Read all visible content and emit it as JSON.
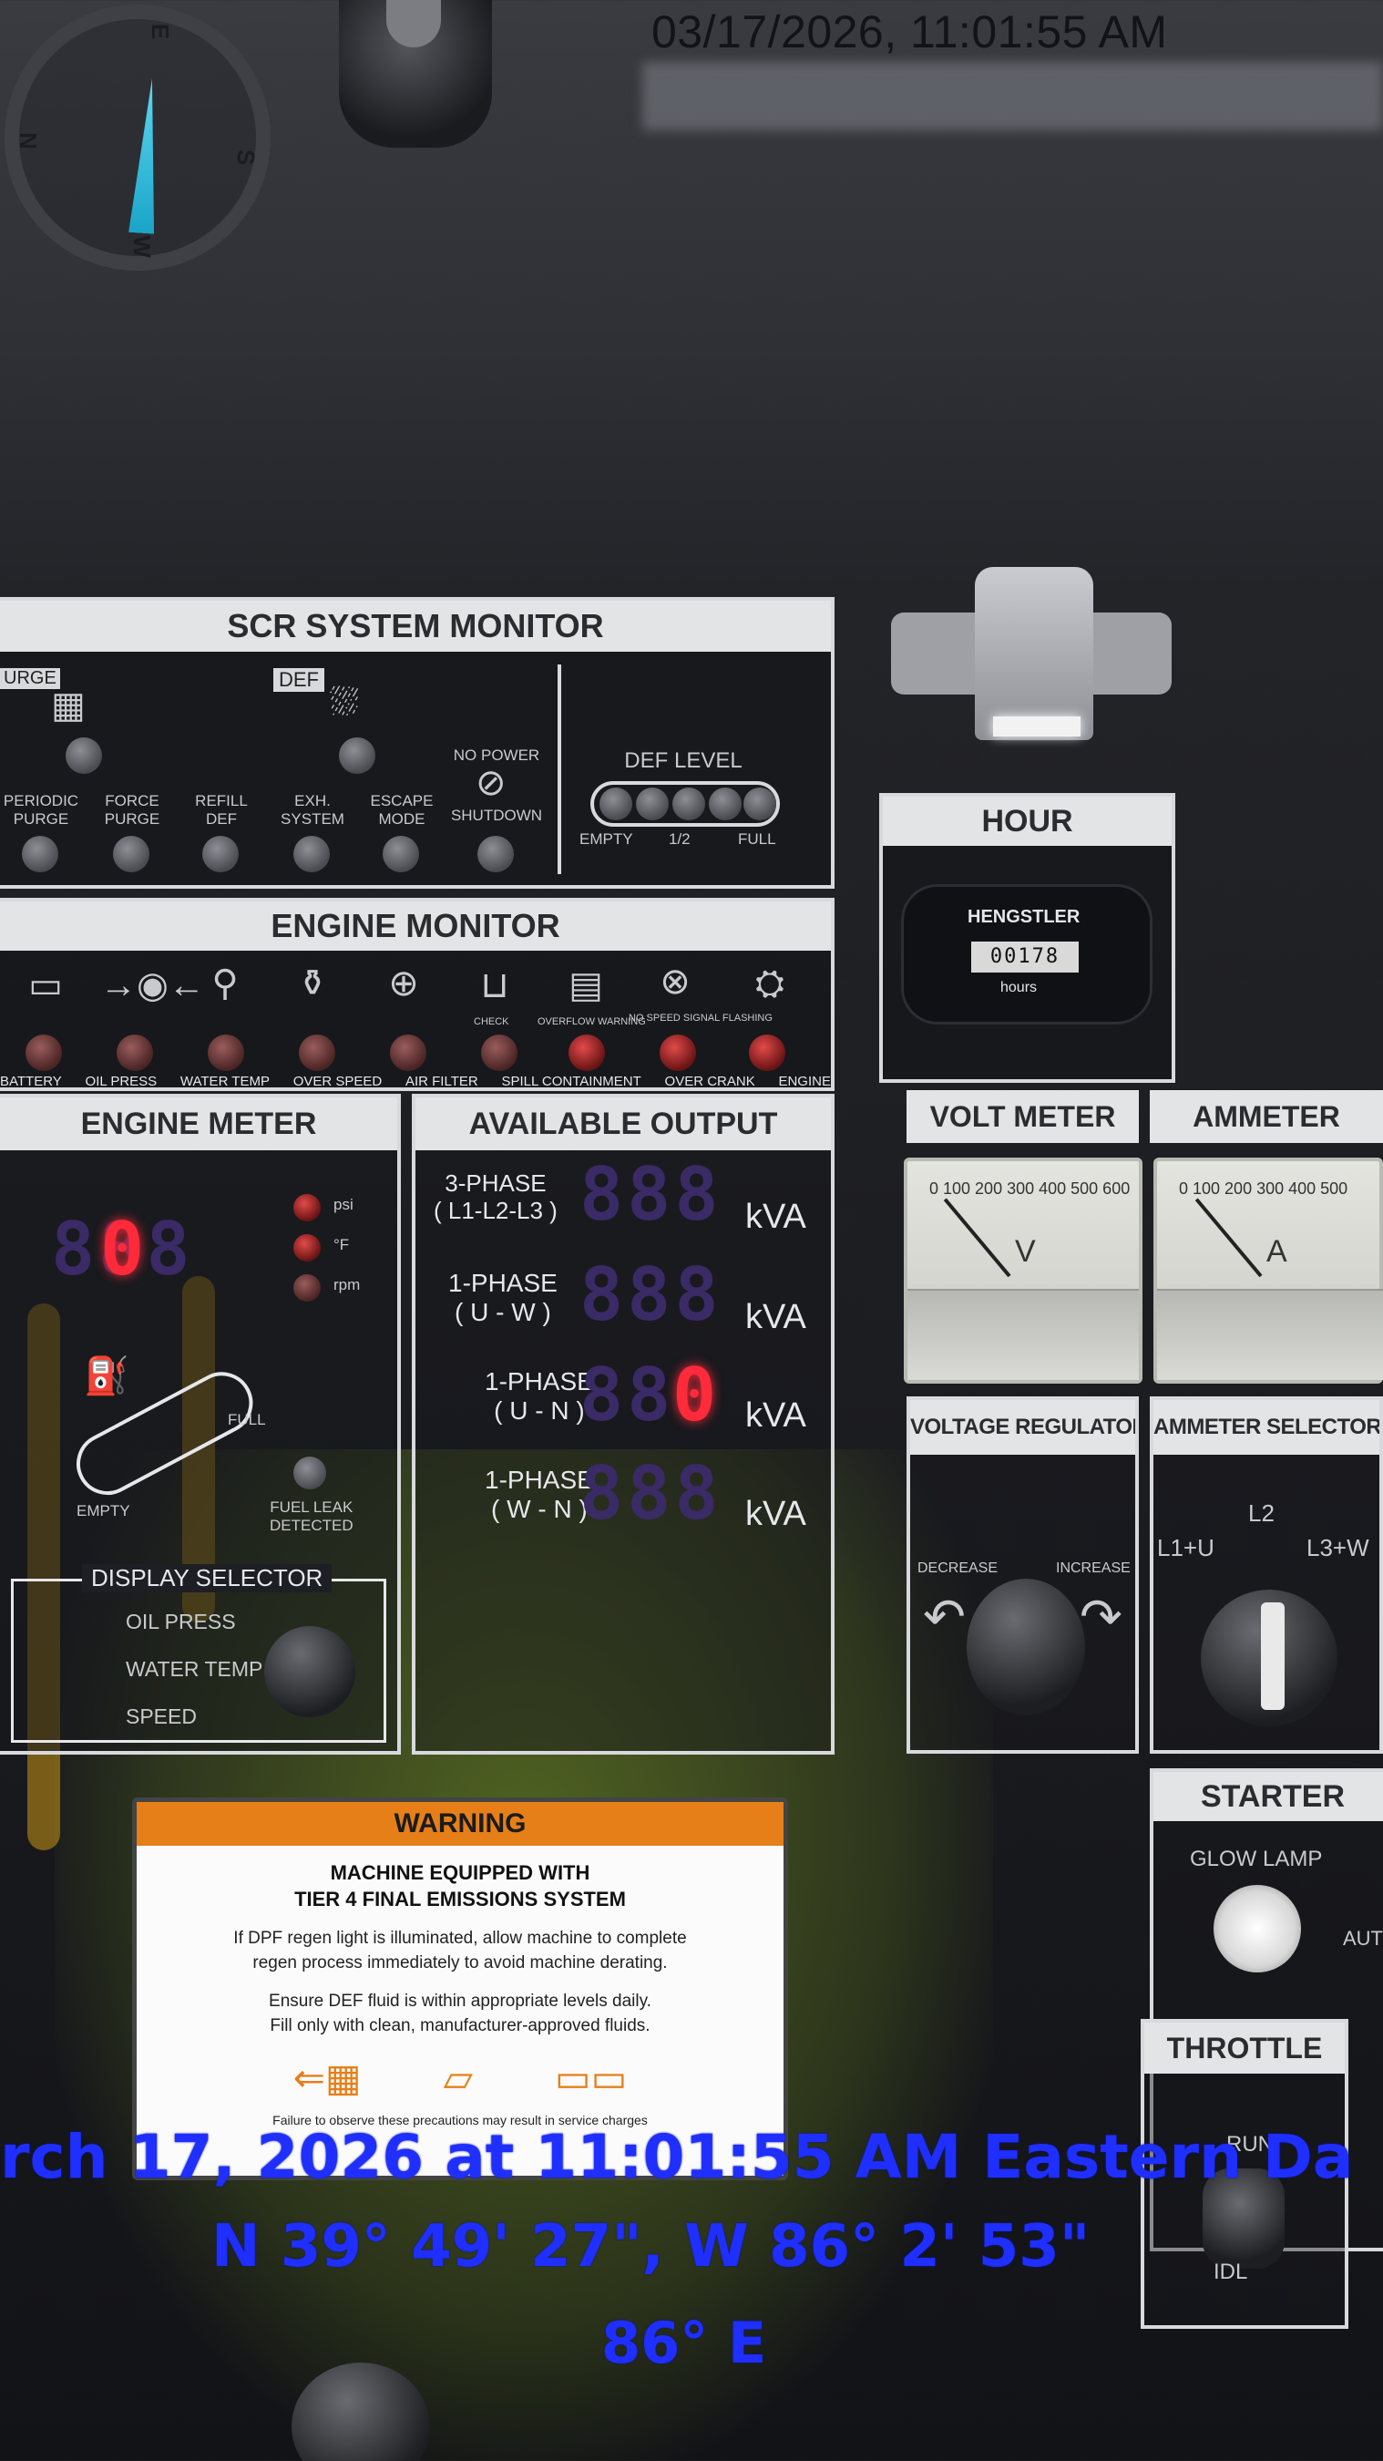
{
  "overlay": {
    "timestamp": "03/17/2026, 11:01:55 AM",
    "date_line": "rch 17, 2026 at 11:01:55 AM Eastern Da",
    "coords_line": "N 39° 49' 27\", W 86° 2' 53\"",
    "heading_line": "86° E"
  },
  "compass": {
    "n": "N",
    "e": "E",
    "s": "S",
    "w": "W",
    "needle_color": "#1aa4c8"
  },
  "scr_monitor": {
    "title": "SCR SYSTEM MONITOR",
    "tags": {
      "purge": "URGE",
      "def": "DEF"
    },
    "lights": [
      "PERIODIC\nPURGE",
      "FORCE\nPURGE",
      "REFILL\nDEF",
      "EXH.\nSYSTEM",
      "ESCAPE\nMODE"
    ],
    "no_power": "NO POWER",
    "shutdown": "SHUTDOWN",
    "def_level": {
      "title": "DEF LEVEL",
      "empty": "EMPTY",
      "half": "1/2",
      "full": "FULL"
    }
  },
  "engine_monitor": {
    "title": "ENGINE MONITOR",
    "icon_labels": [
      "CHECK",
      "OVERFLOW WARNING",
      "NO SPEED SIGNAL FLASHING"
    ],
    "bottom_labels": [
      "BATTERY",
      "OIL PRESS",
      "WATER TEMP",
      "OVER SPEED",
      "AIR FILTER",
      "SPILL CONTAINMENT",
      "OVER CRANK",
      "ENGINE"
    ]
  },
  "hour": {
    "title": "HOUR",
    "brand": "HENGSTLER",
    "unit": "hours",
    "reading": "00178"
  },
  "engine_meter": {
    "title": "ENGINE METER",
    "display": "0",
    "units": [
      "psi",
      "°F",
      "rpm"
    ],
    "fuel_full": "FULL",
    "fuel_empty": "EMPTY",
    "fuel_leak": "FUEL LEAK\nDETECTED",
    "selector_title": "DISPLAY SELECTOR",
    "selector_options": [
      "OIL PRESS",
      "WATER TEMP",
      "SPEED"
    ]
  },
  "available_output": {
    "title": "AVAILABLE OUTPUT",
    "rows": [
      {
        "phase": "3-PHASE\n( L1-L2-L3 )",
        "display": "888",
        "unit": "kVA"
      },
      {
        "phase": "1-PHASE\n( U - W )",
        "display": "888",
        "unit": "kVA"
      },
      {
        "phase": "1-PHASE\n( U - N )",
        "display": "0",
        "unit": "kVA"
      },
      {
        "phase": "1-PHASE\n( W - N )",
        "display": "888",
        "unit": "kVA"
      }
    ]
  },
  "volt_meter": {
    "title": "VOLT METER",
    "scale": "0  100  200  300  400  500  600",
    "unit": "V",
    "value": 0
  },
  "ammeter": {
    "title": "AMMETER",
    "scale": "0   100   200   300   400   500",
    "unit": "A",
    "value": 0
  },
  "voltage_regulator": {
    "title": "VOLTAGE REGULATOR",
    "decrease": "DECREASE",
    "increase": "INCREASE"
  },
  "ammeter_selector": {
    "title": "AMMETER SELECTOR",
    "positions": [
      "L1+U",
      "L2",
      "L3+W"
    ]
  },
  "starter": {
    "title": "STARTER",
    "glow_lamp": "GLOW LAMP",
    "auto": "AUT"
  },
  "throttle": {
    "title": "THROTTLE",
    "run": "RUN",
    "idle": "IDL"
  },
  "warning": {
    "header": "WARNING",
    "title": "MACHINE EQUIPPED WITH\nTIER 4 FINAL EMISSIONS SYSTEM",
    "p1": "If DPF regen light is illuminated, allow machine to complete\nregen process immediately to avoid machine derating.",
    "p2": "Ensure DEF fluid is within appropriate levels daily.\nFill only with clean, manufacturer-approved fluids.",
    "footer": "Failure to observe these precautions may result in service charges"
  },
  "colors": {
    "overlay_text": "#1e2fff",
    "warning_bar": "#e67f18",
    "led_lit": "#ff2a3a"
  }
}
